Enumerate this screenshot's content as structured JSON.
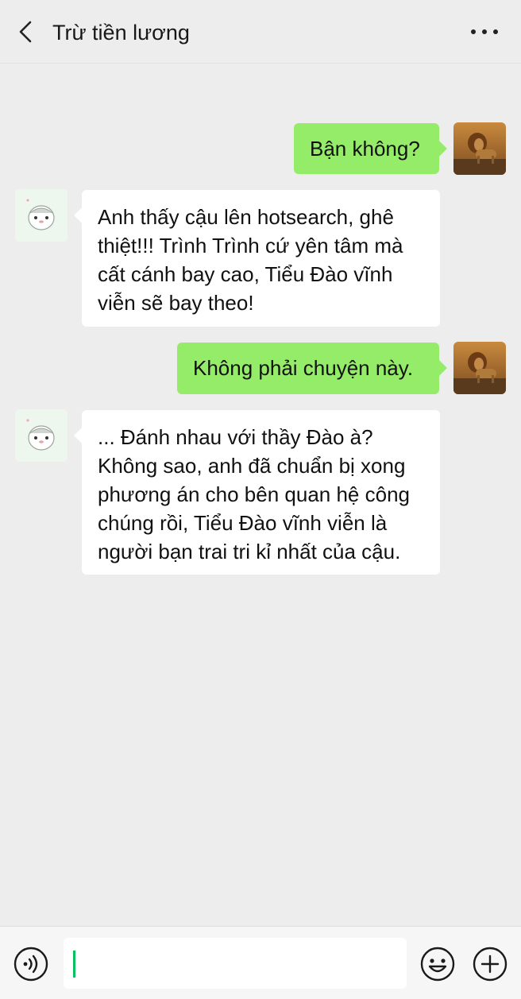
{
  "header": {
    "title": "Trừ tiền lương",
    "back_icon": "chevron-left-icon",
    "more_icon": "more-horizontal-icon"
  },
  "messages": [
    {
      "sender": "me",
      "text": "Bận không?"
    },
    {
      "sender": "other",
      "lines": [
        "Anh thấy cậu lên hotsearch, ghê",
        "thiệt!!! Trình Trình cứ yên tâm mà",
        "cất cánh bay cao, Tiểu Đào vĩnh",
        "viễn sẽ bay theo!"
      ]
    },
    {
      "sender": "me",
      "text": "Không phải chuyện này."
    },
    {
      "sender": "other",
      "lines": [
        "... Đánh nhau với thầy Đào à?",
        "Không sao, anh đã chuẩn bị xong",
        "phương án cho bên quan hệ công",
        "chúng rồi, Tiểu Đào vĩnh viễn là",
        "người bạn trai tri kỉ nhất của cậu."
      ]
    }
  ],
  "avatars": {
    "me": "lion-avatar",
    "other": "hamster-avatar"
  },
  "input_bar": {
    "value": "",
    "voice_icon": "voice-icon",
    "emoji_icon": "emoji-icon",
    "plus_icon": "plus-circle-icon"
  },
  "colors": {
    "background": "#ededed",
    "my_bubble": "#95ec69",
    "other_bubble": "#ffffff",
    "caret": "#07c160"
  }
}
